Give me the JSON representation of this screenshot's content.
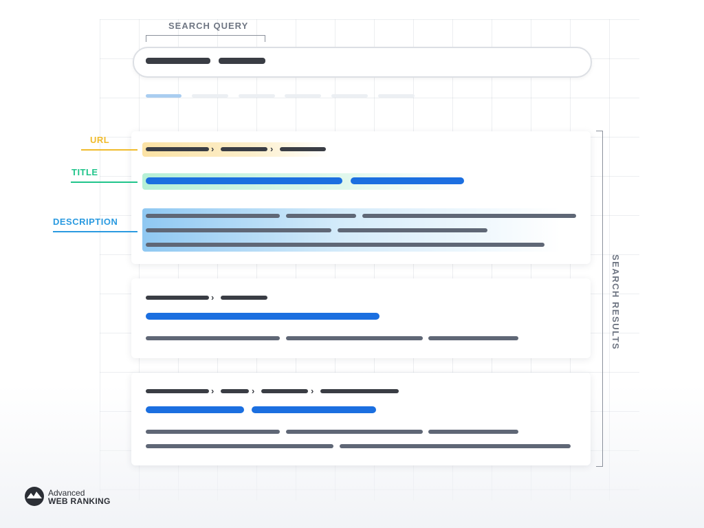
{
  "labels": {
    "search_query": "SEARCH QUERY",
    "url": "URL",
    "title": "TITLE",
    "description": "DESCRIPTION",
    "search_results": "SEARCH RESULTS"
  },
  "colors": {
    "url": "#f0bb2b",
    "title": "#1fc48a",
    "description": "#2a9ae0",
    "link_blue": "#1b6fe0"
  },
  "brand": {
    "line1": "Advanced",
    "line2": "WEB RANKING",
    "icon": "awr-globe-logo-icon"
  }
}
